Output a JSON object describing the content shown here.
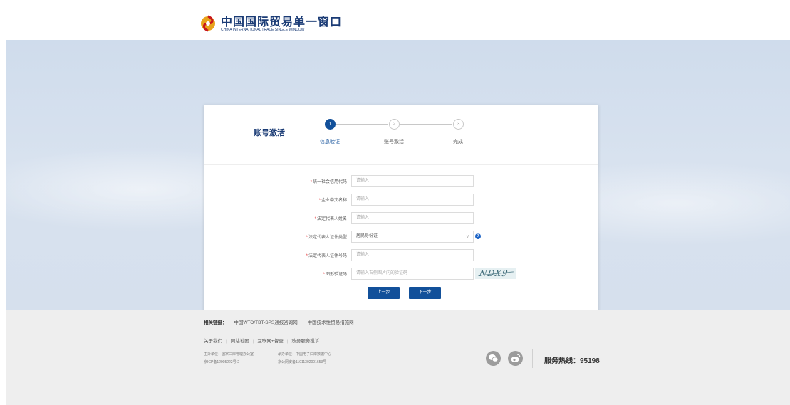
{
  "header": {
    "title_cn": "中国国际贸易单一窗口",
    "title_en": "CHINA INTERNATIONAL TRADE SINGLE WINDOW"
  },
  "card": {
    "title": "账号激活",
    "steps": [
      {
        "num": "1",
        "label": "信息验证",
        "state": "active"
      },
      {
        "num": "2",
        "label": "账号激活",
        "state": "todo"
      },
      {
        "num": "3",
        "label": "完成",
        "state": "todo"
      }
    ]
  },
  "form": {
    "credit_code": {
      "label": "统一社会信用代码",
      "placeholder": "请输入"
    },
    "company_name": {
      "label": "企业中文名称",
      "placeholder": "请输入"
    },
    "legal_rep_name": {
      "label": "法定代表人姓名",
      "placeholder": "请输入"
    },
    "id_type": {
      "label": "法定代表人证件类型",
      "value": "居民身份证"
    },
    "id_number": {
      "label": "法定代表人证件号码",
      "placeholder": "请输入"
    },
    "captcha": {
      "label": "图形验证码",
      "placeholder": "请输入右侧图片内的验证码",
      "image_text": "NDX9"
    },
    "required_mark": "*",
    "help_icon": "?"
  },
  "buttons": {
    "prev": "上一步",
    "next": "下一步"
  },
  "footer": {
    "links_title": "相关链接：",
    "links": [
      "中国WTO/TBT-SPS通报咨询网",
      "中国技术性贸易措施网"
    ],
    "nav": [
      "关于我们",
      "网站地图",
      "互联网+督查",
      "政务服务投诉"
    ],
    "nav_sep": "|",
    "sponsor": "主办单位：国家口岸管理办公室",
    "icp": "京ICP备12005222号-2",
    "organizer": "承办单位：中国电子口岸数据中心",
    "police": "京公网安备11011302001653号",
    "hotline": "服务热线：95198"
  },
  "colors": {
    "primary": "#12509a",
    "required": "#e4393c",
    "hero_bg": "#d6e0ed",
    "footer_bg": "#eeeeee"
  },
  "icons": {
    "logo": "single-window-logo-icon",
    "wechat": "wechat-icon",
    "weibo": "weibo-icon",
    "help": "help-circle-icon",
    "select": "chevron-down-icon"
  }
}
